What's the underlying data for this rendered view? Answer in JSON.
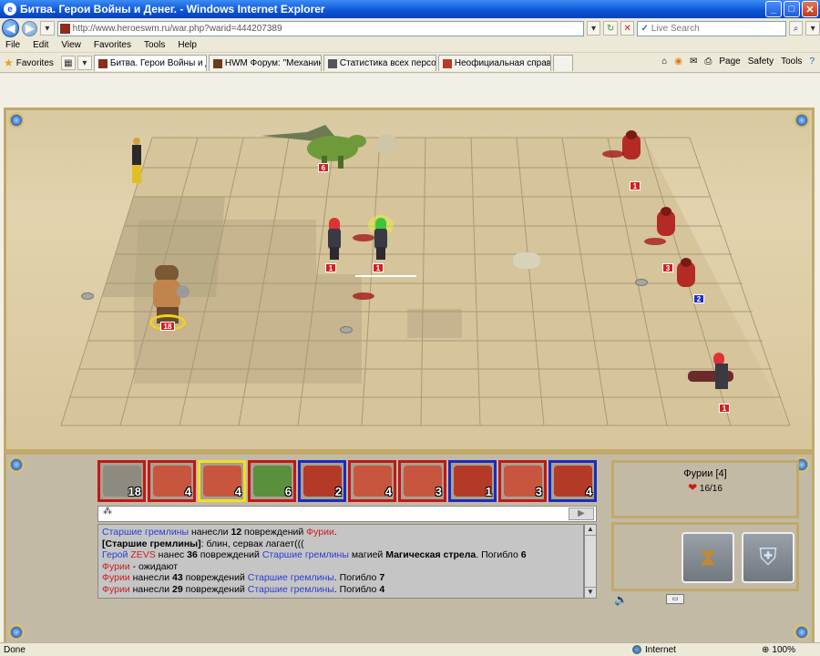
{
  "window": {
    "title": "Битва. Герои Войны и Денег. - Windows Internet Explorer"
  },
  "address": {
    "url": "http://www.heroeswm.ru/war.php?warid=444207389",
    "search_placeholder": "Live Search"
  },
  "menu": {
    "items": [
      "File",
      "Edit",
      "View",
      "Favorites",
      "Tools",
      "Help"
    ]
  },
  "favorites": {
    "label": "Favorites"
  },
  "tabs": [
    {
      "label": "Битва. Герои Войны и Д..."
    },
    {
      "label": "HWM Форум: \"Механика но..."
    },
    {
      "label": "Статистика всех персонаж..."
    },
    {
      "label": "Неофициальная справка по..."
    }
  ],
  "commandbar": {
    "page": "Page",
    "safety": "Safety",
    "tools": "Tools"
  },
  "battlefield": {
    "units": [
      {
        "name": "dragon",
        "stack": "6",
        "side": "red"
      },
      {
        "name": "fury-1",
        "stack": "1",
        "side": "red"
      },
      {
        "name": "fury-active",
        "stack": "1",
        "side": "red"
      },
      {
        "name": "minotaur",
        "stack": "18",
        "side": "red"
      },
      {
        "name": "imp-top",
        "stack": "1",
        "side": "red"
      },
      {
        "name": "imp-mid",
        "stack": "3",
        "side": "red"
      },
      {
        "name": "gremlin-blue",
        "stack": "2",
        "side": "blue"
      },
      {
        "name": "fury-bottom",
        "stack": "1",
        "side": "red"
      }
    ]
  },
  "queue": [
    {
      "count": "18",
      "side": "red",
      "color": "#8d8b80"
    },
    {
      "count": "4",
      "side": "red",
      "color": "#c8553d"
    },
    {
      "count": "4",
      "side": "active",
      "color": "#c8553d"
    },
    {
      "count": "6",
      "side": "red",
      "color": "#5a8f3c"
    },
    {
      "count": "2",
      "side": "blue",
      "color": "#b43a28"
    },
    {
      "count": "4",
      "side": "red",
      "color": "#c8553d"
    },
    {
      "count": "3",
      "side": "red",
      "color": "#c8553d"
    },
    {
      "count": "1",
      "side": "blue",
      "color": "#b43a28"
    },
    {
      "count": "3",
      "side": "red",
      "color": "#c8553d"
    },
    {
      "count": "4",
      "side": "blue",
      "color": "#b43a28"
    }
  ],
  "log": {
    "l1a": "Старшие гремлины",
    "l1b": " нанесли ",
    "l1c": "12",
    "l1d": " повреждений ",
    "l1e": "Фурии",
    "l1f": ".",
    "l2a": "[Старшие гремлины]",
    "l2b": ": блин, сервак лагает(((",
    "l3a": "Герой ",
    "l3b": "ZEVS",
    "l3c": " нанес ",
    "l3d": "36",
    "l3e": " повреждений ",
    "l3f": "Старшие гремлины",
    "l3g": " магией ",
    "l3h": "Магическая стрела",
    "l3i": ". Погибло ",
    "l3j": "6",
    "l4a": "Фурии",
    "l4b": " - ожидают",
    "l5a": "Фурии",
    "l5b": " нанесли ",
    "l5c": "43",
    "l5d": " повреждений ",
    "l5e": "Старшие гремлины",
    "l5f": ". Погибло ",
    "l5g": "7",
    "l6a": "Фурии",
    "l6b": " нанесли ",
    "l6c": "29",
    "l6d": " повреждений ",
    "l6e": "Старшие гремлины",
    "l6f": ". Погибло ",
    "l6g": "4"
  },
  "unit_info": {
    "name": "Фурии [4]",
    "hp": "16/16"
  },
  "status": {
    "left": "Done",
    "zone": "Internet",
    "zoom": "100%"
  }
}
